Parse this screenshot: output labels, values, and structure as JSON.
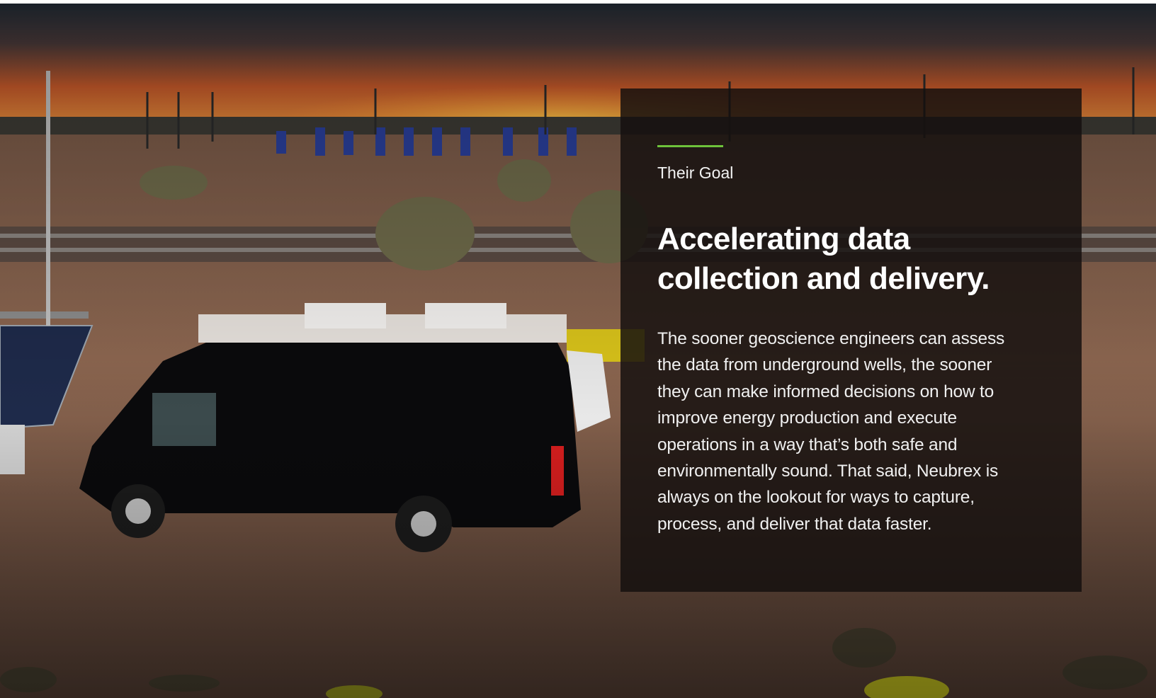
{
  "goal_card": {
    "eyebrow": "Their Goal",
    "headline": "Accelerating data collection and delivery.",
    "body": "The sooner geoscience engineers can assess the data from underground wells, the sooner they can make informed decisions on how to improve energy production and execute operations in a way that’s both safe and environmentally sound. That said, Neubrex is always on the lookout for ways to capture, process, and deliver that data faster."
  },
  "colors": {
    "accent": "#6ec23b",
    "card_background": "#14100e",
    "text": "#ffffff"
  }
}
